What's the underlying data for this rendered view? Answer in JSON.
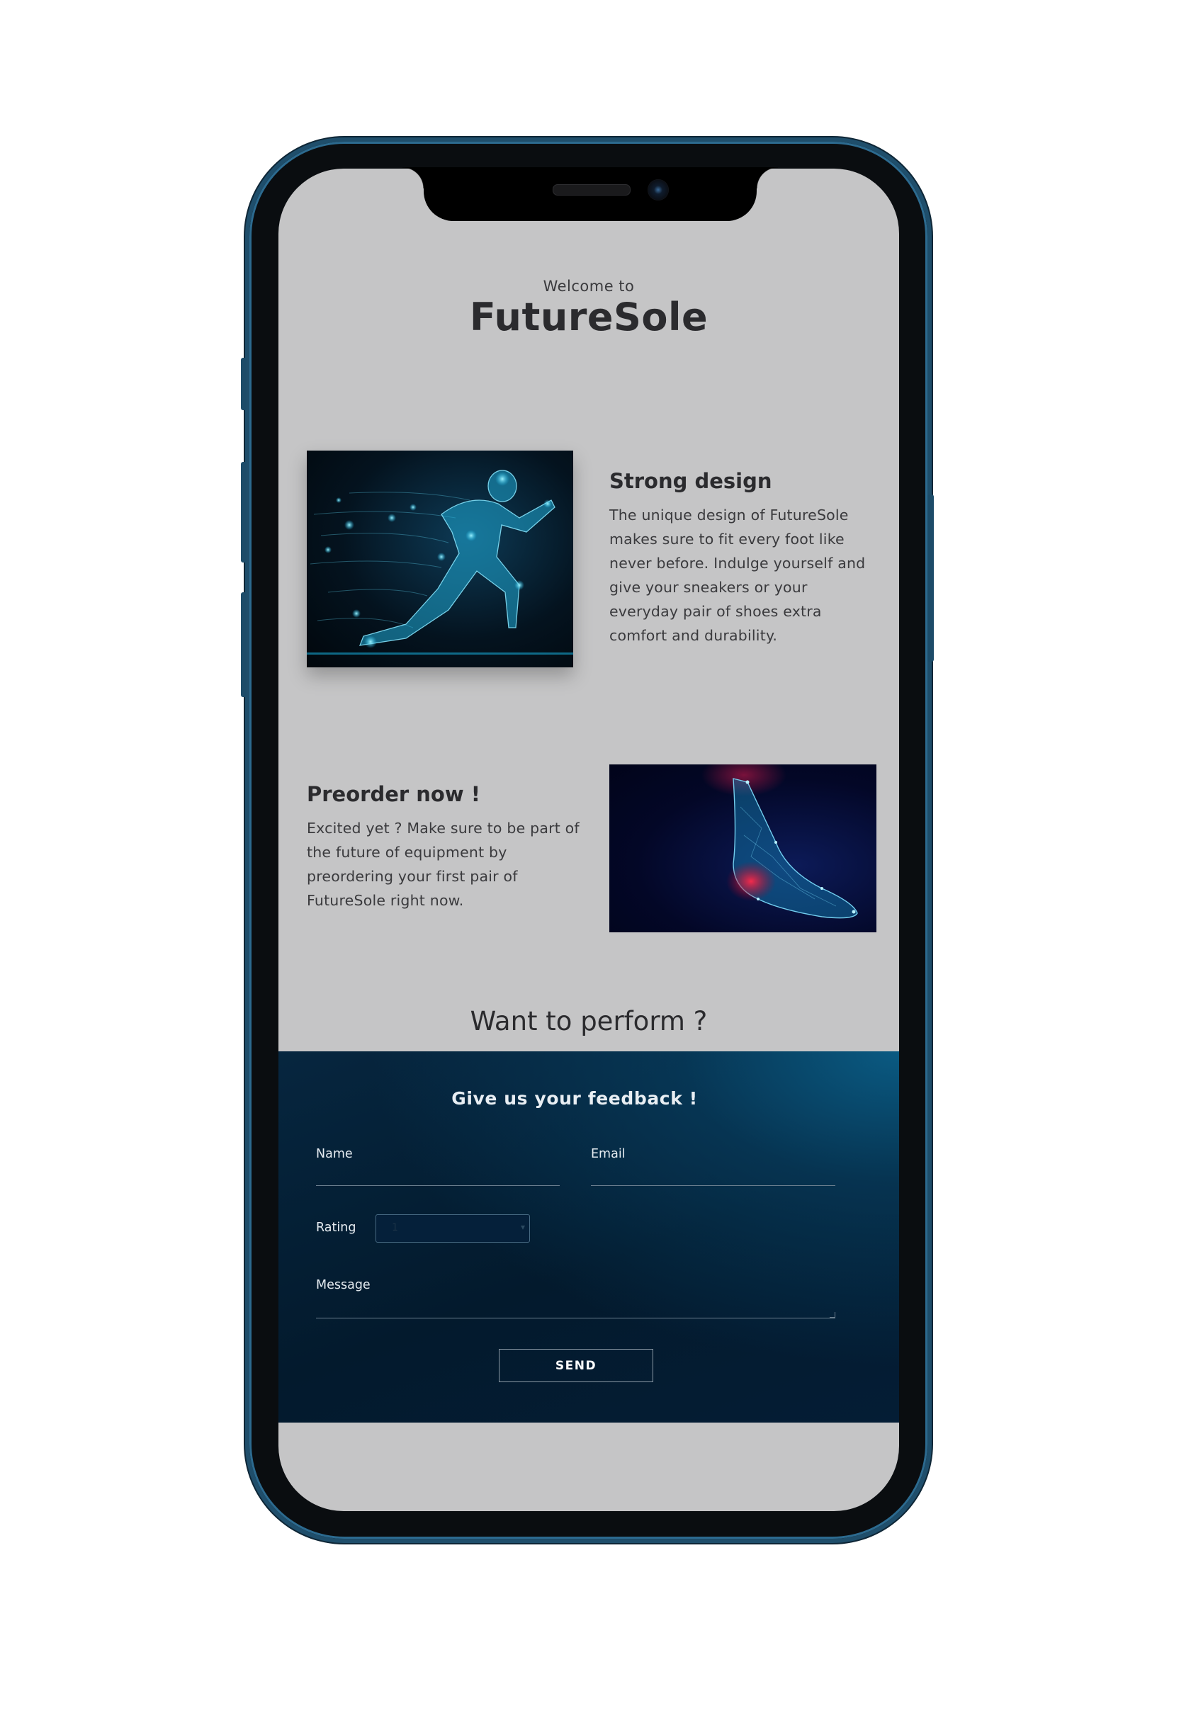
{
  "header": {
    "welcome": "Welcome to",
    "brand": "FutureSole"
  },
  "features": [
    {
      "title": "Strong design",
      "text": "The unique design of FutureSole makes sure to fit every foot like never before. Indulge yourself and give your sneakers or your everyday pair of shoes extra comfort and durability.",
      "image": "running-figure-image"
    },
    {
      "title": "Preorder now !",
      "text": "Excited yet ? Make sure to be part of the future of equipment by preordering your first pair of FutureSole right now.",
      "image": "foot-scan-image"
    }
  ],
  "cta": {
    "heading": "Want to perform ?"
  },
  "feedback_form": {
    "title": "Give us your feedback !",
    "name_label": "Name",
    "email_label": "Email",
    "rating_label": "Rating",
    "rating_value": "1",
    "message_label": "Message",
    "send_label": "SEND"
  },
  "colors": {
    "screen_bg": "#c5c5c6",
    "form_bg": "#031a2d",
    "accent": "#0a5a82",
    "frame": "#1f4e6b"
  }
}
